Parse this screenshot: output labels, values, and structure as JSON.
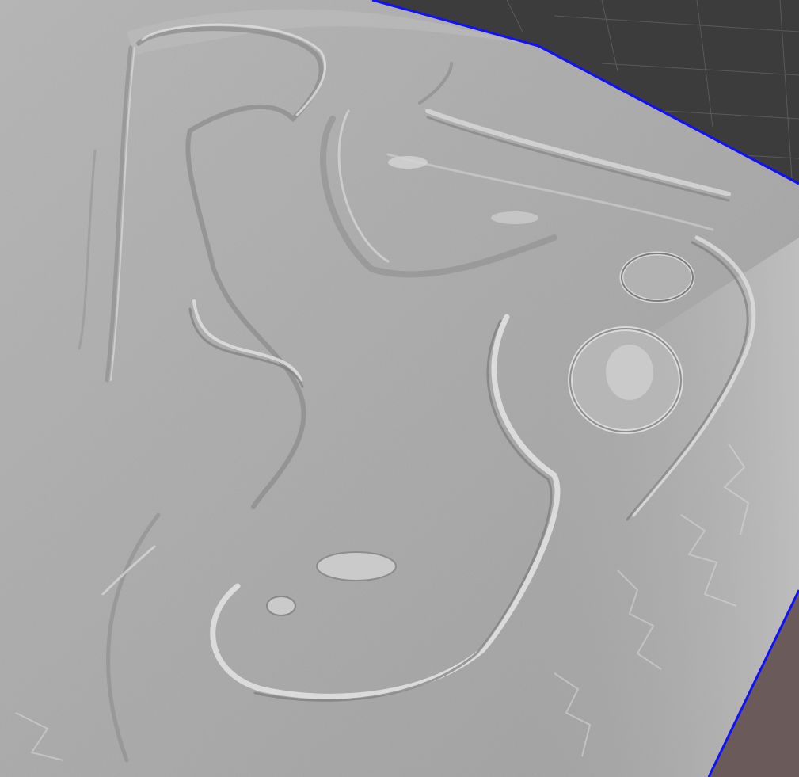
{
  "scene": {
    "view": "3d-viewport",
    "object": "terrain-mesh",
    "shading": "flat-gray",
    "background_color": "#3c3c3c",
    "grid_color": "#5a5a5a",
    "mesh_color": "#a8a8a8",
    "outline_color": "#1010ff",
    "underside_color": "#6b5a5a"
  }
}
